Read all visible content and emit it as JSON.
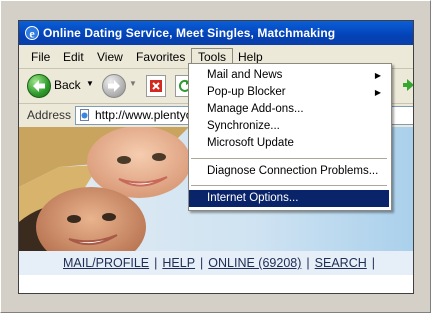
{
  "window": {
    "title": "Online Dating Service, Meet Singles, Matchmaking"
  },
  "menubar": {
    "items": [
      "File",
      "Edit",
      "View",
      "Favorites",
      "Tools",
      "Help"
    ]
  },
  "toolbar": {
    "back_label": "Back"
  },
  "address": {
    "label": "Address",
    "url": "http://www.plentyo"
  },
  "tools_menu": {
    "items": [
      {
        "label": "Mail and News",
        "submenu": true
      },
      {
        "label": "Pop-up Blocker",
        "submenu": true
      },
      {
        "label": "Manage Add-ons...",
        "submenu": false
      },
      {
        "label": "Synchronize...",
        "submenu": false
      },
      {
        "label": "Microsoft Update",
        "submenu": false
      },
      {
        "label": "Diagnose Connection Problems...",
        "submenu": false
      },
      {
        "label": "Internet Options...",
        "submenu": false,
        "highlighted": true
      }
    ]
  },
  "site_nav": {
    "links": [
      "MAIL/PROFILE",
      "HELP",
      "ONLINE (69208)",
      "SEARCH"
    ],
    "separator": "|"
  },
  "colors": {
    "titlebar": "#0442b7",
    "highlight": "#0a246a",
    "nav_bg": "#e6eef8"
  }
}
